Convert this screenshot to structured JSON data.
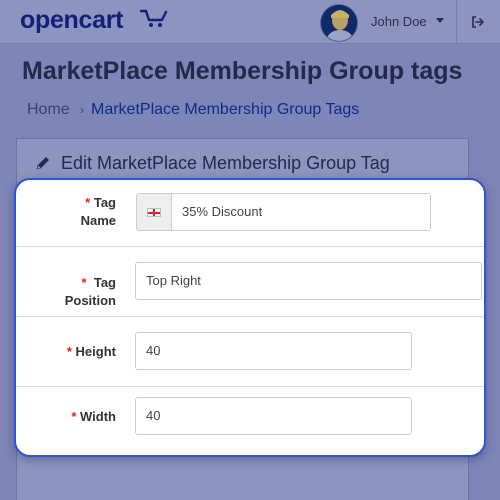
{
  "header": {
    "logo_text": "opencart",
    "user_name": "John Doe",
    "icons": {
      "logo": "cart-icon",
      "user": "avatar",
      "menu": "caret-down-icon",
      "logout": "logout-icon"
    }
  },
  "page": {
    "title": "MarketPlace Membership Group tags",
    "breadcrumb": {
      "home": "Home",
      "separator": "›",
      "current": "MarketPlace Membership Group Tags"
    }
  },
  "panel": {
    "title": "Edit MarketPlace Membership Group Tag",
    "icon": "pencil-icon"
  },
  "form": {
    "required_mark": "*",
    "tag_name": {
      "label_1": "Tag",
      "label_2": "Name",
      "value": "35% Discount",
      "language_icon": "flag-icon"
    },
    "tag_position": {
      "label_1": "Tag",
      "label_2": "Position",
      "value": "Top Right"
    },
    "height": {
      "label": "Height",
      "value": "40"
    },
    "width": {
      "label": "Width",
      "value": "40"
    }
  },
  "colors": {
    "accent": "#3154d6",
    "required": "#e32020",
    "link": "#102c8a"
  }
}
